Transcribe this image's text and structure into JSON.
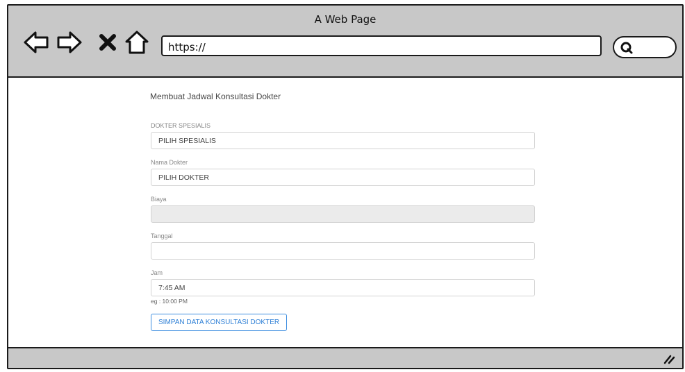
{
  "window": {
    "title": "A Web Page"
  },
  "address_bar": {
    "value": "https://"
  },
  "icons": {
    "back": "arrow-left-icon",
    "forward": "arrow-right-icon",
    "stop": "close-icon",
    "home": "home-icon",
    "search": "search-icon",
    "resize": "resize-grip-icon"
  },
  "form": {
    "title": "Membuat Jadwal Konsultasi Dokter",
    "specialist": {
      "label": "DOKTER SPESIALIS",
      "value": "PILIH SPESIALIS"
    },
    "doctor": {
      "label": "Nama Dokter",
      "value": "PILIH DOKTER"
    },
    "cost": {
      "label": "Biaya",
      "value": ""
    },
    "date": {
      "label": "Tanggal",
      "value": ""
    },
    "time": {
      "label": "Jam",
      "value": "7:45 AM",
      "hint": "eg : 10:00 PM"
    },
    "submit_label": "SIMPAN DATA KONSULTASI DOKTER"
  },
  "colors": {
    "chrome": "#c8c8c8",
    "button_accent": "#2f80d6",
    "disabled_field": "#ebebeb"
  }
}
